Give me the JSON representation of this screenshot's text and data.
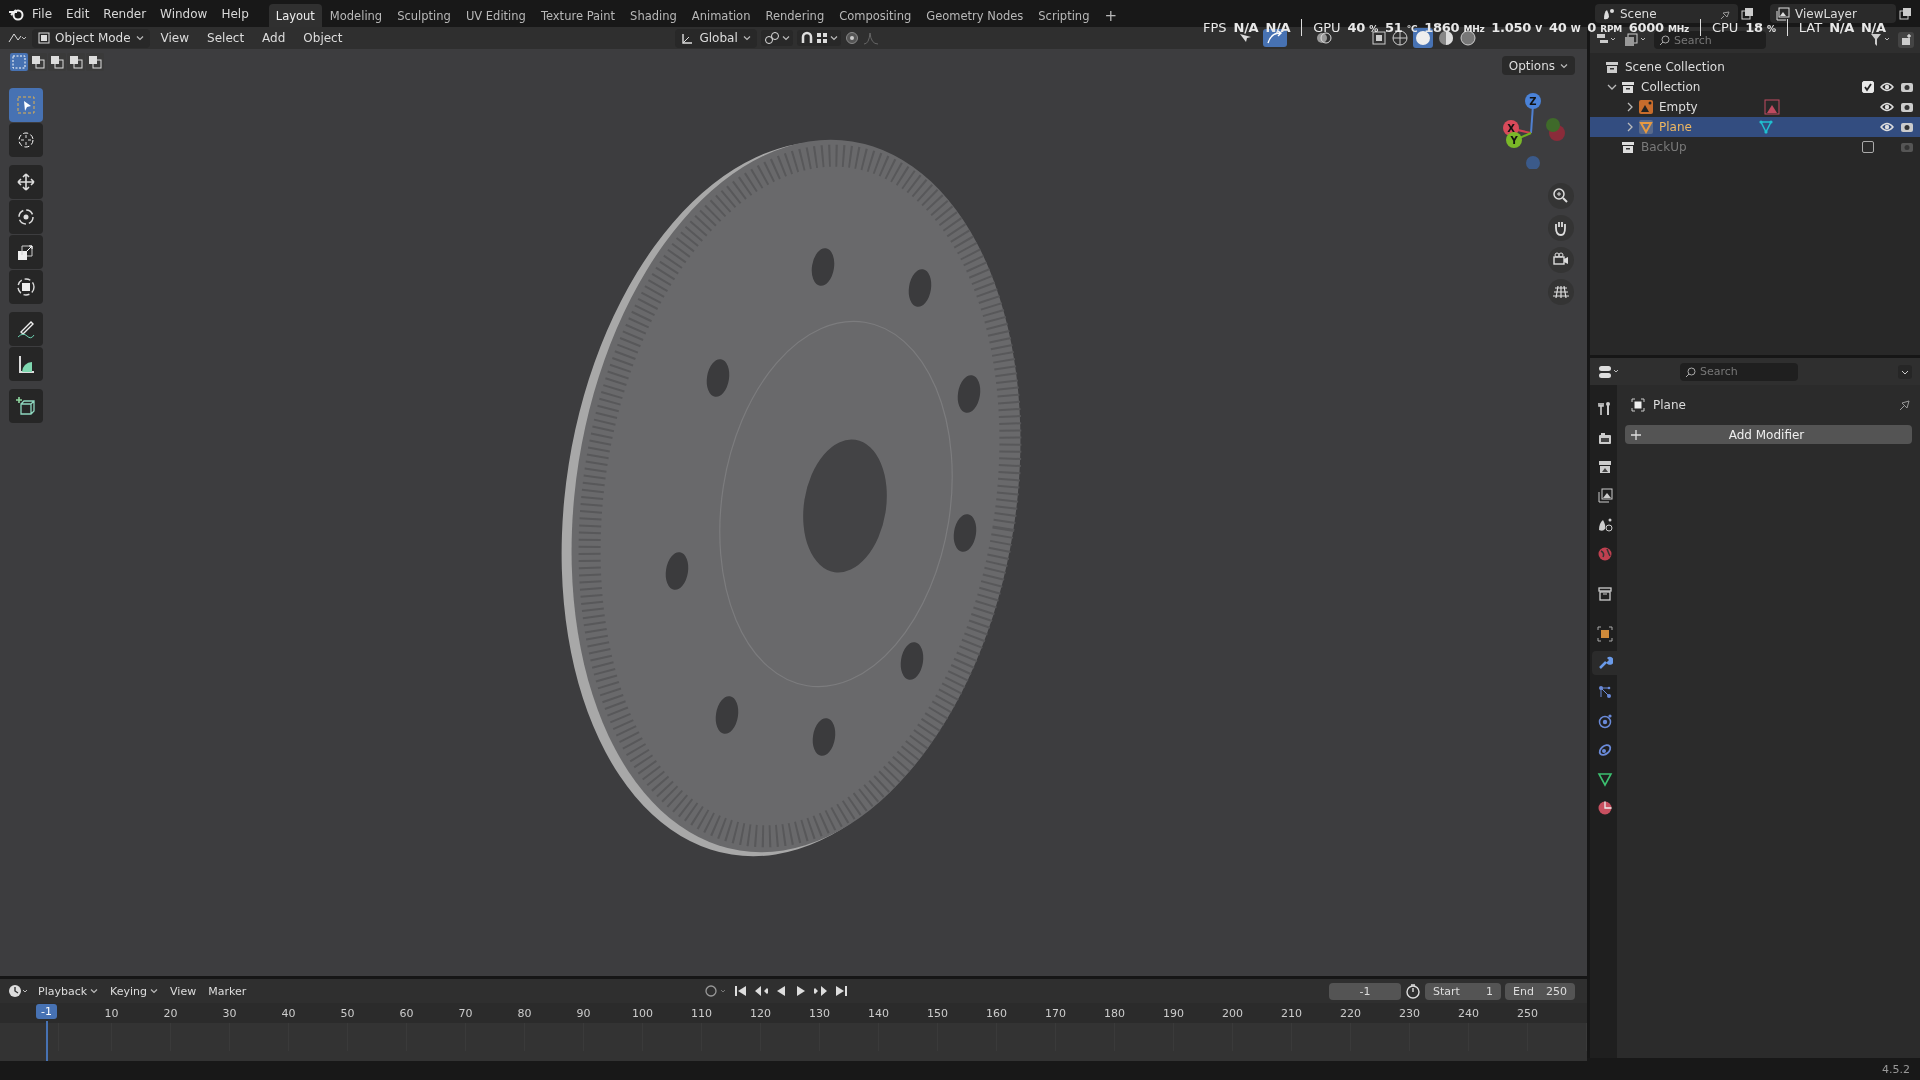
{
  "menu": [
    "File",
    "Edit",
    "Render",
    "Window",
    "Help"
  ],
  "workspaces": [
    {
      "label": "Layout",
      "selected": true
    },
    {
      "label": "Modeling",
      "selected": false
    },
    {
      "label": "Sculpting",
      "selected": false
    },
    {
      "label": "UV Editing",
      "selected": false
    },
    {
      "label": "Texture Paint",
      "selected": false
    },
    {
      "label": "Shading",
      "selected": false
    },
    {
      "label": "Animation",
      "selected": false
    },
    {
      "label": "Rendering",
      "selected": false
    },
    {
      "label": "Compositing",
      "selected": false
    },
    {
      "label": "Geometry Nodes",
      "selected": false
    },
    {
      "label": "Scripting",
      "selected": false
    }
  ],
  "add_workspace": "+",
  "scene_field": "Scene",
  "view_layer_field": "ViewLayer",
  "perf_overlay": [
    {
      "label": "FPS",
      "values": [
        {
          "value": "N/A"
        },
        {
          "value": "N/A"
        }
      ]
    },
    {
      "label": "GPU",
      "values": [
        {
          "value": "40",
          "unit": "%"
        },
        {
          "value": "51",
          "unit": "°C"
        },
        {
          "value": "1860",
          "unit": "MHz"
        },
        {
          "value": "1.050",
          "unit": "V"
        },
        {
          "value": "40",
          "unit": "W"
        },
        {
          "value": "0",
          "unit": "RPM"
        },
        {
          "value": "6000",
          "unit": "MHz"
        }
      ]
    },
    {
      "label": "CPU",
      "values": [
        {
          "value": "18",
          "unit": "%"
        }
      ]
    },
    {
      "label": "LAT",
      "values": [
        {
          "value": "N/A"
        },
        {
          "value": "N/A"
        }
      ]
    }
  ],
  "viewport_header": {
    "mode": "Object Mode",
    "menus": [
      "View",
      "Select",
      "Add",
      "Object"
    ],
    "orientation": "Global",
    "options": "Options"
  },
  "gizmo_axes": [
    "Z",
    "X",
    "Y"
  ],
  "tools": [
    {
      "kind": "select",
      "selected": true
    },
    {
      "kind": "cursor",
      "selected": false
    },
    {
      "kind": "move",
      "selected": false
    },
    {
      "kind": "rotate",
      "selected": false
    },
    {
      "kind": "scale",
      "selected": false
    },
    {
      "kind": "transform",
      "selected": false
    },
    {
      "kind": "annotate",
      "selected": false
    },
    {
      "kind": "measure",
      "selected": false
    },
    {
      "kind": "add-cube",
      "selected": false
    }
  ],
  "outliner": {
    "search_placeholder": "Search",
    "tree": [
      {
        "name": "Scene Collection",
        "kind": "scene",
        "children": [
          {
            "name": "Collection",
            "kind": "collection",
            "expanded": true,
            "checked": true,
            "children": [
              {
                "name": "Empty",
                "kind": "empty",
                "selected": false,
                "expanded": false
              },
              {
                "name": "Plane",
                "kind": "mesh",
                "selected": true,
                "expanded": false
              }
            ]
          },
          {
            "name": "BackUp",
            "kind": "collection",
            "checked": false
          }
        ]
      }
    ]
  },
  "properties": {
    "search_placeholder": "Search",
    "object_name": "Plane",
    "add_modifier": "Add Modifier",
    "tabs": [
      {
        "kind": "tool",
        "selected": false
      },
      {
        "kind": "render",
        "selected": false
      },
      {
        "kind": "output",
        "selected": false
      },
      {
        "kind": "view-layer",
        "selected": false
      },
      {
        "kind": "scene",
        "selected": false
      },
      {
        "kind": "world",
        "selected": false
      },
      {
        "kind": "collection",
        "selected": false
      },
      {
        "kind": "object",
        "selected": false
      },
      {
        "kind": "modifier",
        "selected": true
      },
      {
        "kind": "particles",
        "selected": false
      },
      {
        "kind": "physics",
        "selected": false
      },
      {
        "kind": "constraints",
        "selected": false
      },
      {
        "kind": "data",
        "selected": false
      },
      {
        "kind": "material",
        "selected": false
      }
    ]
  },
  "timeline": {
    "menus": [
      "Playback",
      "Keying",
      "View",
      "Marker"
    ],
    "current_frame": "-1",
    "start_label": "Start",
    "start": "1",
    "end_label": "End",
    "end": "250",
    "playhead": "-1",
    "ticks": [
      "10",
      "20",
      "30",
      "40",
      "50",
      "60",
      "70",
      "80",
      "90",
      "100",
      "110",
      "120",
      "130",
      "140",
      "150",
      "160",
      "170",
      "180",
      "190",
      "200",
      "210",
      "220",
      "230",
      "240",
      "250"
    ]
  },
  "status_bar": {
    "version": "4.5.2"
  }
}
